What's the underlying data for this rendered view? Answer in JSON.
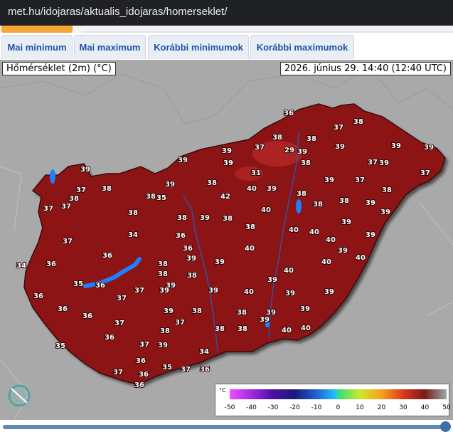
{
  "browser": {
    "url": "met.hu/idojaras/aktualis_idojaras/homerseklet/"
  },
  "tabs": [
    {
      "label": "Mai minimum"
    },
    {
      "label": "Mai maximum"
    },
    {
      "label": "Korábbi minimumok"
    },
    {
      "label": "Korábbi maximumok"
    }
  ],
  "map": {
    "title": "Hőmérséklet (2m) (°C)",
    "timestamp": "2026. június 29. 14:40 (12:40 UTC)",
    "station_values": [
      {
        "v": "36"
      },
      {
        "v": "37"
      },
      {
        "v": "38"
      },
      {
        "v": "38"
      },
      {
        "v": "38"
      },
      {
        "v": "39"
      },
      {
        "v": "39"
      },
      {
        "v": "29"
      },
      {
        "v": "39"
      },
      {
        "v": "37"
      },
      {
        "v": "39"
      },
      {
        "v": "39"
      },
      {
        "v": "37"
      },
      {
        "v": "37"
      },
      {
        "v": "38"
      },
      {
        "v": "31"
      },
      {
        "v": "39"
      },
      {
        "v": "39"
      },
      {
        "v": "39"
      },
      {
        "v": "37"
      },
      {
        "v": "38"
      },
      {
        "v": "39"
      },
      {
        "v": "38"
      },
      {
        "v": "39"
      },
      {
        "v": "40"
      },
      {
        "v": "39"
      },
      {
        "v": "38"
      },
      {
        "v": "37"
      },
      {
        "v": "38"
      },
      {
        "v": "38"
      },
      {
        "v": "35"
      },
      {
        "v": "39"
      },
      {
        "v": "42"
      },
      {
        "v": "38"
      },
      {
        "v": "39"
      },
      {
        "v": "38"
      },
      {
        "v": "38"
      },
      {
        "v": "40"
      },
      {
        "v": "38"
      },
      {
        "v": "39"
      },
      {
        "v": "38"
      },
      {
        "v": "37"
      },
      {
        "v": "37"
      },
      {
        "v": "38"
      },
      {
        "v": "38"
      },
      {
        "v": "40"
      },
      {
        "v": "40"
      },
      {
        "v": "39"
      },
      {
        "v": "39"
      },
      {
        "v": "36"
      },
      {
        "v": "36"
      },
      {
        "v": "40"
      },
      {
        "v": "39"
      },
      {
        "v": "40"
      },
      {
        "v": "34"
      },
      {
        "v": "36"
      },
      {
        "v": "37"
      },
      {
        "v": "38"
      },
      {
        "v": "39"
      },
      {
        "v": "39"
      },
      {
        "v": "39"
      },
      {
        "v": "40"
      },
      {
        "v": "34"
      },
      {
        "v": "36"
      },
      {
        "v": "38"
      },
      {
        "v": "39"
      },
      {
        "v": "40"
      },
      {
        "v": "40"
      },
      {
        "v": "38"
      },
      {
        "v": "35"
      },
      {
        "v": "36"
      },
      {
        "v": "37"
      },
      {
        "v": "39"
      },
      {
        "v": "39"
      },
      {
        "v": "39"
      },
      {
        "v": "39"
      },
      {
        "v": "36"
      },
      {
        "v": "37"
      },
      {
        "v": "40"
      },
      {
        "v": "39"
      },
      {
        "v": "39"
      },
      {
        "v": "36"
      },
      {
        "v": "38"
      },
      {
        "v": "39"
      },
      {
        "v": "39"
      },
      {
        "v": "38"
      },
      {
        "v": "35"
      },
      {
        "v": "36"
      },
      {
        "v": "38"
      },
      {
        "v": "37"
      },
      {
        "v": "39"
      },
      {
        "v": "40"
      },
      {
        "v": "37"
      },
      {
        "v": "38"
      },
      {
        "v": "40"
      },
      {
        "v": "36"
      },
      {
        "v": "37"
      },
      {
        "v": "38"
      },
      {
        "v": "39"
      },
      {
        "v": "34"
      },
      {
        "v": "36"
      },
      {
        "v": "36"
      },
      {
        "v": "37"
      },
      {
        "v": "35"
      },
      {
        "v": "36"
      },
      {
        "v": "37"
      },
      {
        "v": "36"
      }
    ],
    "legend": {
      "unit": "°C",
      "ticks": [
        "-50",
        "-40",
        "-30",
        "-20",
        "-10",
        "0",
        "10",
        "20",
        "30",
        "40",
        "50"
      ]
    }
  },
  "colors": {
    "tab_text": "#1f55a7",
    "map_fill": "#8c1414",
    "accent": "#f5a533"
  }
}
